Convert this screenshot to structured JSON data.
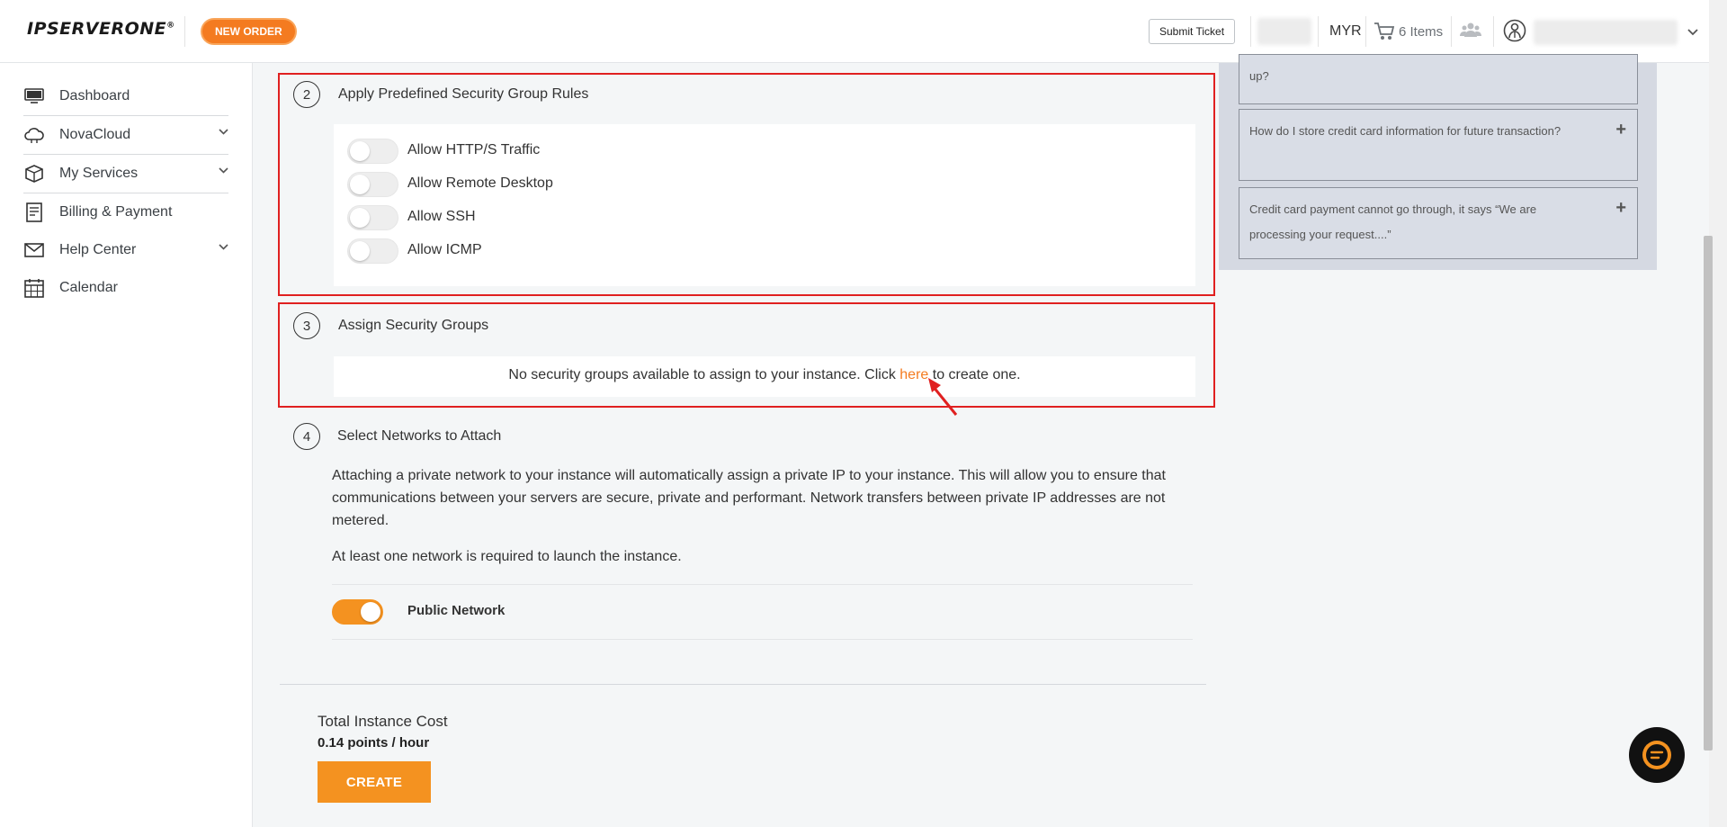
{
  "header": {
    "logo_text": "IPSERVERONE",
    "logo_mark": "®",
    "new_order_label": "NEW ORDER",
    "submit_ticket_label": "Submit Ticket",
    "currency": "MYR",
    "cart_label": "6 Items"
  },
  "sidebar": {
    "items": [
      {
        "label": "Dashboard",
        "icon": "monitor-icon",
        "has_children": false
      },
      {
        "label": "NovaCloud",
        "icon": "cloud-icon",
        "has_children": true
      },
      {
        "label": "My Services",
        "icon": "box-icon",
        "has_children": true
      },
      {
        "label": "Billing & Payment",
        "icon": "receipt-icon",
        "has_children": false
      },
      {
        "label": "Help Center",
        "icon": "mail-icon",
        "has_children": true
      },
      {
        "label": "Calendar",
        "icon": "calendar-icon",
        "has_children": false
      }
    ]
  },
  "steps": {
    "rules": {
      "number": "2",
      "title": "Apply Predefined Security Group Rules",
      "toggles": [
        {
          "label": "Allow HTTP/S Traffic",
          "on": false
        },
        {
          "label": "Allow Remote Desktop",
          "on": false
        },
        {
          "label": "Allow SSH",
          "on": false
        },
        {
          "label": "Allow ICMP",
          "on": false
        }
      ]
    },
    "assign": {
      "number": "3",
      "title": "Assign Security Groups",
      "message_before": "No security groups available to assign to your instance. Click ",
      "link": "here",
      "message_after": " to create one."
    },
    "networks": {
      "number": "4",
      "title": "Select Networks to Attach",
      "description": "Attaching a private network to your instance will automatically assign a private IP to your instance. This will allow you to ensure that communications between your servers are secure, private and performant. Network transfers between private IP addresses are not metered.",
      "requirement": "At least one network is required to launch the instance.",
      "public_network_label": "Public Network",
      "public_network_on": true
    }
  },
  "total": {
    "label": "Total Instance Cost",
    "value": "0.14 points / hour",
    "create_label": "CREATE"
  },
  "faq": [
    {
      "question": "up?"
    },
    {
      "question": "How do I store credit card information for future transaction?"
    },
    {
      "question": "Credit card payment cannot go through, it says “We are processing your request....”"
    }
  ],
  "colors": {
    "accent": "#f49220",
    "highlight_border": "#e02020",
    "link": "#f47b20"
  }
}
